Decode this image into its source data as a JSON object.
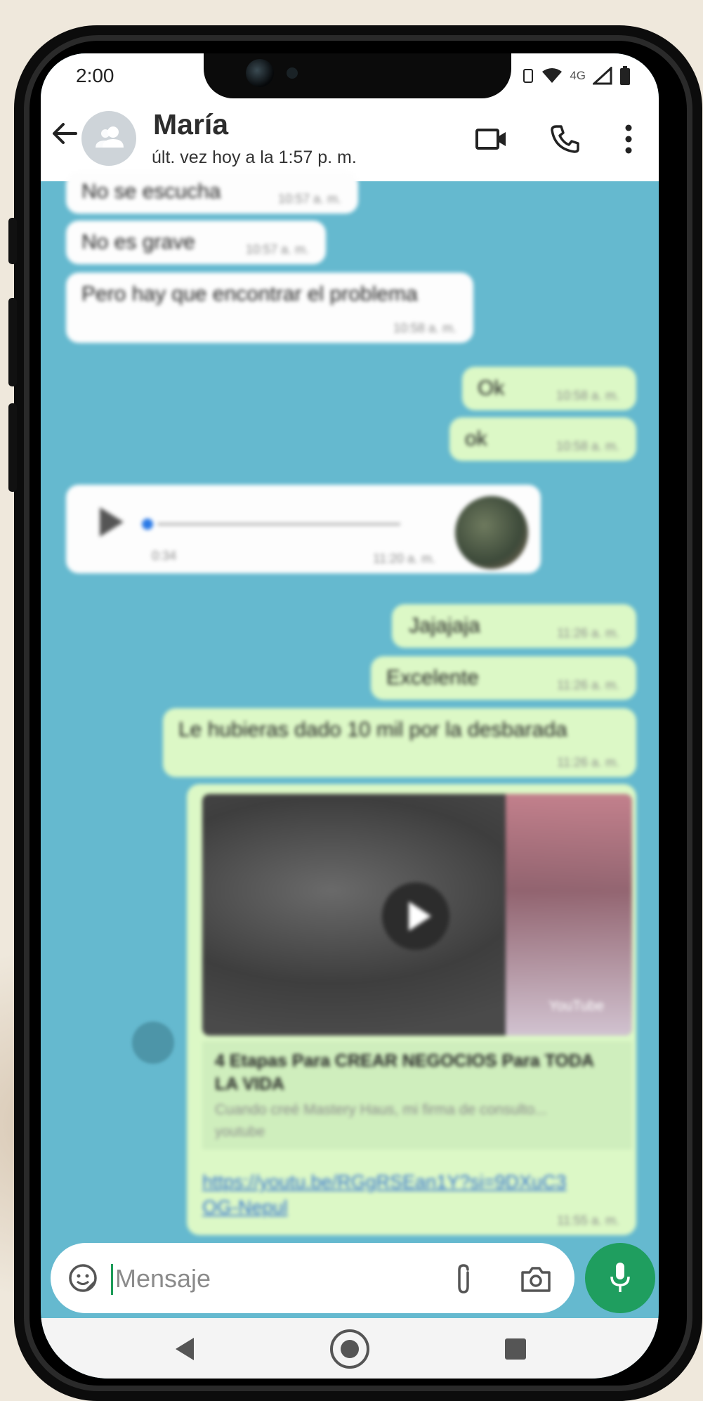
{
  "status_bar": {
    "time": "2:00",
    "network": "4G"
  },
  "header": {
    "contact_name": "María",
    "last_seen": "últ. vez hoy a la 1:57 p. m.",
    "icons": [
      "back-arrow-icon",
      "group-avatar-icon",
      "video-call-icon",
      "voice-call-icon",
      "more-options-icon"
    ]
  },
  "messages": [
    {
      "dir": "in",
      "text": "No se escucha",
      "time": "10:57 a. m."
    },
    {
      "dir": "in",
      "text": "No es grave",
      "time": "10:57 a. m."
    },
    {
      "dir": "in",
      "text": "Pero hay que encontrar el problema",
      "time": "10:58 a. m."
    },
    {
      "dir": "out",
      "text": "Ok",
      "time": "10:58 a. m."
    },
    {
      "dir": "out",
      "text": "ok",
      "time": "10:58 a. m."
    },
    {
      "dir": "in",
      "type": "voice",
      "duration": "0:34",
      "time": "11:20 a. m."
    },
    {
      "dir": "out",
      "text": "Jajajaja",
      "time": "11:26 a. m."
    },
    {
      "dir": "out",
      "text": "Excelente",
      "time": "11:26 a. m."
    },
    {
      "dir": "out",
      "text": "Le hubieras dado 10 mil por la desbarada",
      "time": "11:26 a. m."
    },
    {
      "dir": "out",
      "type": "link",
      "provider": "YouTube",
      "title": "4 Etapas Para CREAR NEGOCIOS Para TODA LA VIDA",
      "description": "Cuando creé Mastery Haus, mi firma de consulto...",
      "domain": "youtube",
      "url": "https://youtu.be/RGgRSEan1Y?si=9DXuC3OG-Nepul",
      "time": "11:55 a. m."
    }
  ],
  "composer": {
    "placeholder": "Mensaje"
  },
  "colors": {
    "chat_bg": "#65b9cf",
    "outgoing": "#dcf8c6",
    "incoming": "#fdfdfd",
    "accent": "#1f9e5f"
  }
}
